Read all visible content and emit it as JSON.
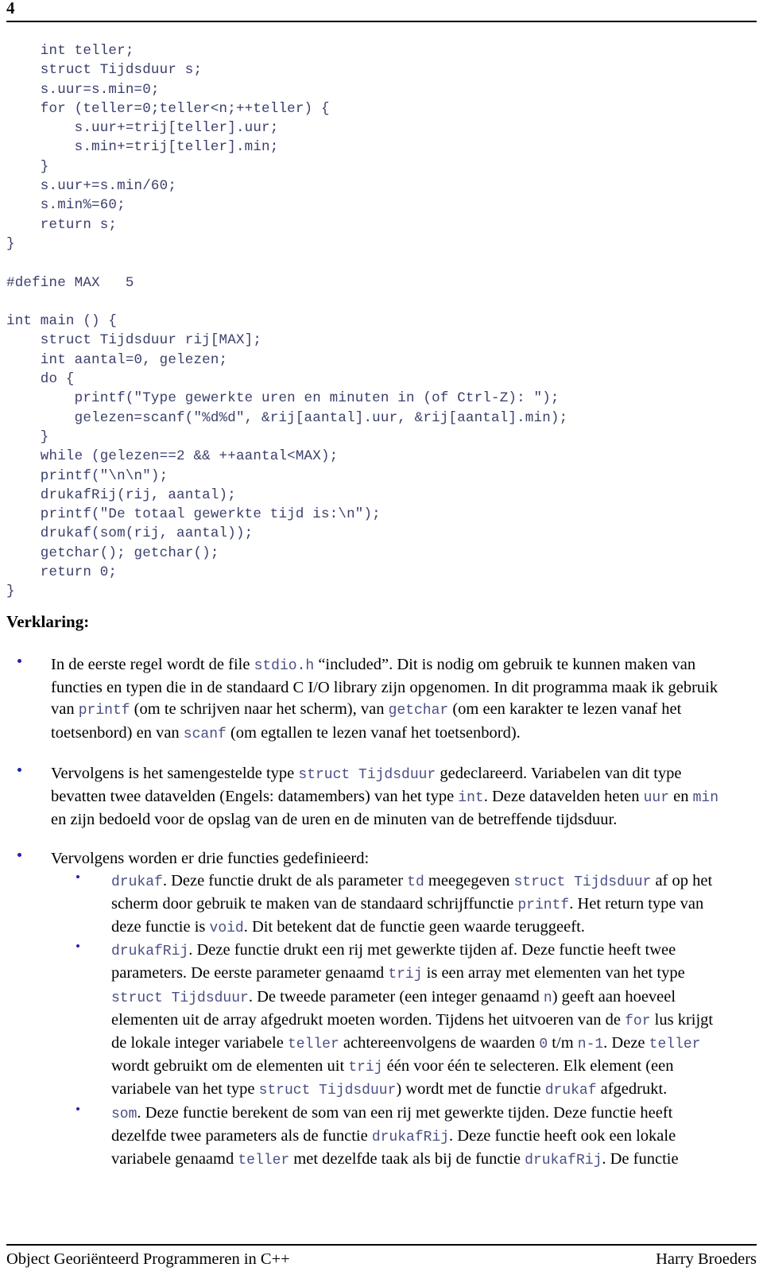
{
  "header": {
    "page_number": "4"
  },
  "code": {
    "lines": [
      "    int teller;",
      "    struct Tijdsduur s;",
      "    s.uur=s.min=0;",
      "    for (teller=0;teller<n;++teller) {",
      "        s.uur+=trij[teller].uur;",
      "        s.min+=trij[teller].min;",
      "    }",
      "    s.uur+=s.min/60;",
      "    s.min%=60;",
      "    return s;",
      "}",
      "",
      "#define MAX   5",
      "",
      "int main () {",
      "    struct Tijdsduur rij[MAX];",
      "    int aantal=0, gelezen;",
      "    do {",
      "        printf(\"Type gewerkte uren en minuten in (of Ctrl-Z): \");",
      "        gelezen=scanf(\"%d%d\", &rij[aantal].uur, &rij[aantal].min);",
      "    }",
      "    while (gelezen==2 && ++aantal<MAX);",
      "    printf(\"\\n\\n\");",
      "    drukafRij(rij, aantal);",
      "    printf(\"De totaal gewerkte tijd is:\\n\");",
      "    drukaf(som(rij, aantal));",
      "    getchar(); getchar();",
      "    return 0;",
      "}"
    ]
  },
  "section": {
    "heading": "Verklaring:"
  },
  "explanation": {
    "bullet1": {
      "part1": "In de eerste regel wordt de file ",
      "code1": "stdio.h",
      "part2": " “included”. Dit is nodig om gebruik te kunnen maken van functies en typen die in de standaard C I/O library zijn opgenomen. In dit programma maak ik gebruik van ",
      "code2": "printf",
      "part3": " (om te schrijven naar het scherm), van ",
      "code3": "getchar",
      "part4": " (om een karakter te lezen vanaf het toetsenbord) en van ",
      "code4": "scanf",
      "part5": " (om egtallen te lezen vanaf het toetsenbord)."
    },
    "bullet2": {
      "part1": "Vervolgens is het samengestelde type ",
      "code1": "struct Tijdsduur",
      "part2": " gedeclareerd. Variabelen van dit type bevatten twee datavelden (Engels: datamembers) van het type ",
      "code2": "int",
      "part3": ". Deze datavelden heten ",
      "code3": "uur",
      "part4": " en ",
      "code4": "min",
      "part5": " en zijn bedoeld voor de opslag van de uren en de minuten van de betreffende tijdsduur."
    },
    "bullet3": {
      "intro": "Vervolgens worden er drie functies gedefinieerd:",
      "sub1": {
        "code1": "drukaf",
        "part1": ". Deze functie drukt de als parameter ",
        "code2": "td",
        "part2": " meegegeven ",
        "code3": "struct Tijdsduur",
        "part3": " af op het scherm door gebruik te maken van de standaard schrijffunctie ",
        "code4": "printf",
        "part4": ". Het return type van deze functie is ",
        "code5": "void",
        "part5": ". Dit betekent dat de functie geen waarde teruggeeft."
      },
      "sub2": {
        "code1": "drukafRij",
        "part1": ". Deze functie drukt een rij met gewerkte tijden af. Deze functie heeft twee parameters. De eerste parameter genaamd ",
        "code2": "trij",
        "part2": " is een array met elementen van het type ",
        "code3": "struct Tijdsduur",
        "part3": ". De tweede parameter (een integer genaamd ",
        "code4": "n",
        "part4": ") geeft aan hoeveel elementen uit de array afgedrukt moeten worden. Tijdens het uitvoeren van de ",
        "code5": "for",
        "part5": " lus krijgt de lokale integer variabele ",
        "code6": "teller",
        "part6": " achtereenvolgens de waarden ",
        "code7": "0",
        "part7": " t/m ",
        "code8": "n-1",
        "part8": ". Deze ",
        "code9": "teller",
        "part9": " wordt gebruikt om de elementen uit ",
        "code10": "trij",
        "part10": " één voor één te selecteren. Elk element (een variabele van het type ",
        "code11": "struct Tijdsduur",
        "part11": ") wordt met de functie ",
        "code12": "drukaf",
        "part12": " afgedrukt."
      },
      "sub3": {
        "code1": "som",
        "part1": ". Deze functie berekent de som van een rij met gewerkte tijden. Deze functie heeft dezelfde twee parameters als de functie ",
        "code2": "drukafRij",
        "part2": ". Deze functie heeft ook een lokale variabele genaamd ",
        "code3": "teller",
        "part3": " met dezelfde taak als bij de functie ",
        "code4": "drukafRij",
        "part4": ". De functie"
      }
    }
  },
  "footer": {
    "left": "Object Georiënteerd Programmeren in C++",
    "right": "Harry Broeders"
  },
  "colors": {
    "code_text": "#3a3f6b",
    "inline_code": "#4a4f85",
    "bullet": "#2222aa",
    "rule": "#000000"
  }
}
